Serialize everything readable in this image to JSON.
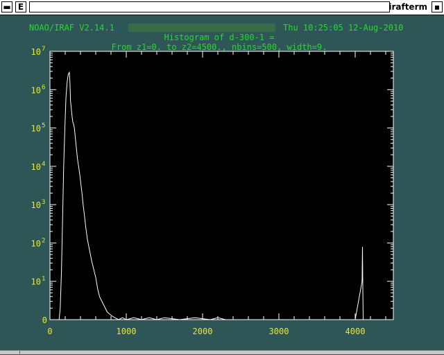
{
  "window": {
    "menu_glyph": "▬",
    "e_label": "E",
    "title": "irafterm",
    "close_glyph": "▪"
  },
  "header": {
    "line1_left": "NOAO/IRAF V2.14.1",
    "line1_right": "Thu 10:25:05 12-Aug-2010",
    "line2": "Histogram of d-300-1 =",
    "line3": "From z1=0. to z2=4500., nbins=500, width=9."
  },
  "colors": {
    "background": "#2f5656",
    "plot_bg": "#000000",
    "header_text": "#22dd22",
    "tick_text": "#e8e830",
    "frame": "#ffffff",
    "curve": "#ffffff"
  },
  "chart_data": {
    "type": "line",
    "title": "Histogram of d-300-1 =",
    "subtitle": "From z1=0. to z2=4500., nbins=500, width=9.",
    "xlabel": "",
    "ylabel": "",
    "xlim": [
      0,
      4500
    ],
    "ylim": [
      0,
      7
    ],
    "y_scale": "log",
    "x_ticks": [
      "0",
      "1000",
      "2000",
      "3000",
      "4000"
    ],
    "y_ticks": [
      {
        "base": "0",
        "exp": ""
      },
      {
        "base": "10",
        "exp": "1"
      },
      {
        "base": "10",
        "exp": "2"
      },
      {
        "base": "10",
        "exp": "3"
      },
      {
        "base": "10",
        "exp": "4"
      },
      {
        "base": "10",
        "exp": "5"
      },
      {
        "base": "10",
        "exp": "6"
      },
      {
        "base": "10",
        "exp": "7"
      }
    ],
    "grid": false,
    "series": [
      {
        "x": [
          0,
          120,
          135,
          150,
          165,
          180,
          195,
          210,
          225,
          240,
          255,
          262,
          270,
          280,
          290,
          300,
          310,
          320,
          330,
          340,
          350,
          360,
          375,
          390,
          405,
          420,
          435,
          450,
          470,
          490,
          510,
          530,
          550,
          575,
          600,
          625,
          650,
          675,
          700,
          725,
          750,
          780,
          810,
          850,
          900,
          950,
          1000,
          1100,
          1200,
          1300,
          1400,
          1500,
          1700,
          1900,
          2100,
          2200,
          2300,
          2500,
          3000,
          3500,
          4000,
          4090,
          4095,
          4100,
          4105,
          4110,
          4120,
          4500
        ],
        "logy": [
          0,
          0,
          0.3,
          1.2,
          2.6,
          4.0,
          5.0,
          5.8,
          6.2,
          6.4,
          6.45,
          6.2,
          5.7,
          5.5,
          5.3,
          5.15,
          5.1,
          5.0,
          4.8,
          4.6,
          4.4,
          4.2,
          4.0,
          3.8,
          3.55,
          3.3,
          3.0,
          2.75,
          2.4,
          2.1,
          1.9,
          1.7,
          1.5,
          1.3,
          1.1,
          0.8,
          0.6,
          0.5,
          0.4,
          0.3,
          0.2,
          0.15,
          0.1,
          0.05,
          0,
          0.05,
          0,
          0.05,
          0,
          0.05,
          0,
          0.05,
          0,
          0.05,
          0,
          0.05,
          0,
          0,
          0,
          0,
          0,
          1.0,
          1.9,
          0.8,
          0,
          0,
          0,
          0
        ]
      }
    ]
  }
}
